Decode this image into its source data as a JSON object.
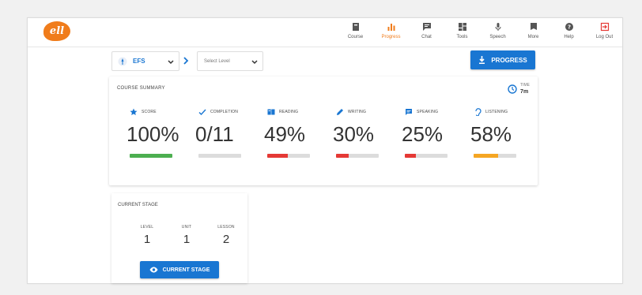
{
  "app": {
    "logo_text": "ell",
    "brand_color": "#f07c1b",
    "accent_color": "#1976d2"
  },
  "nav": {
    "items": [
      {
        "label": "Course",
        "icon": "course-icon"
      },
      {
        "label": "Progress",
        "icon": "progress-bar-icon",
        "active": true
      },
      {
        "label": "Chat",
        "icon": "chat-icon"
      },
      {
        "label": "Tools",
        "icon": "tools-icon"
      },
      {
        "label": "Speech",
        "icon": "microphone-icon"
      },
      {
        "label": "More",
        "icon": "more-icon"
      },
      {
        "label": "Help",
        "icon": "help-icon"
      },
      {
        "label": "Log Out",
        "icon": "logout-icon"
      }
    ]
  },
  "toolbar": {
    "course": "EFS",
    "level_placeholder": "Select Level",
    "progress_button": "PROGRESS"
  },
  "summary": {
    "title": "COURSE SUMMARY",
    "time_label": "TIME",
    "time_value": "7m",
    "metrics": [
      {
        "label": "SCORE",
        "value": "100%",
        "percent": 100,
        "color": "#4caf50",
        "icon": "star-icon"
      },
      {
        "label": "COMPLETION",
        "value": "0/11",
        "percent": 0,
        "color": "#9e9e9e",
        "icon": "check-icon"
      },
      {
        "label": "READING",
        "value": "49%",
        "percent": 49,
        "color": "#e53935",
        "icon": "book-icon"
      },
      {
        "label": "WRITING",
        "value": "30%",
        "percent": 30,
        "color": "#e53935",
        "icon": "pencil-icon"
      },
      {
        "label": "SPEAKING",
        "value": "25%",
        "percent": 25,
        "color": "#e53935",
        "icon": "speech-bubble-icon"
      },
      {
        "label": "LISTENING",
        "value": "58%",
        "percent": 58,
        "color": "#f5a623",
        "icon": "ear-icon"
      }
    ]
  },
  "stage": {
    "title": "CURRENT STAGE",
    "level_label": "LEVEL",
    "level_value": "1",
    "unit_label": "UNIT",
    "unit_value": "1",
    "lesson_label": "LESSON",
    "lesson_value": "2",
    "button": "CURRENT STAGE"
  }
}
